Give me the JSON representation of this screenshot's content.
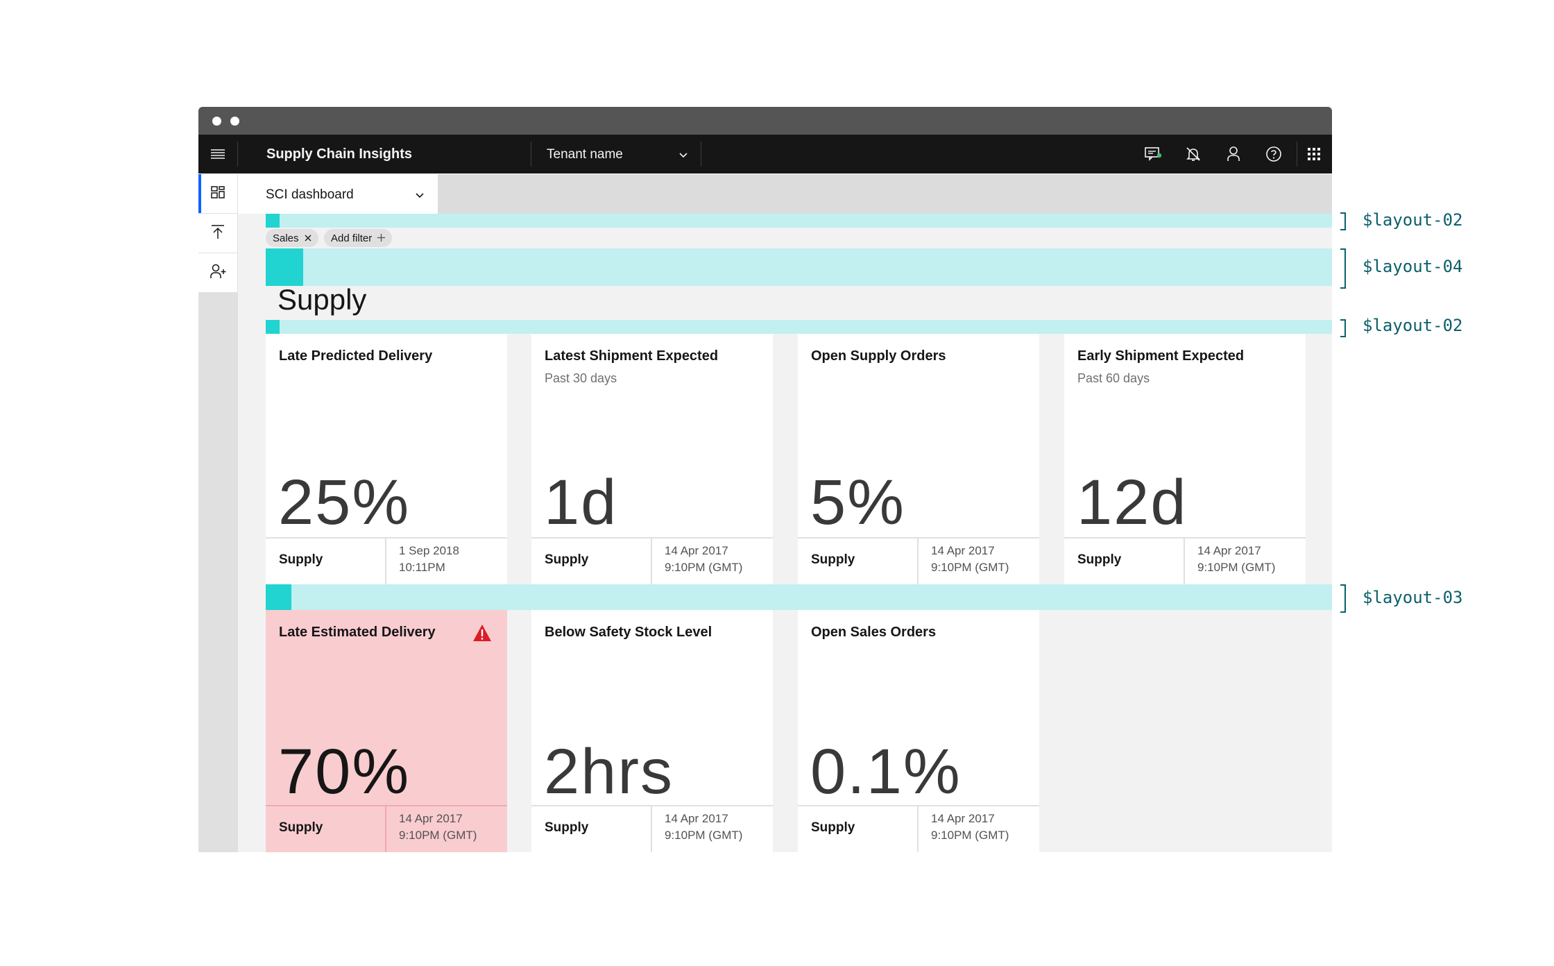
{
  "header": {
    "app_title": "Supply Chain Insights",
    "tenant_label": "Tenant name",
    "icons": [
      "menu-icon",
      "chat-icon",
      "notification-off-icon",
      "user-icon",
      "help-icon",
      "app-switcher-icon"
    ]
  },
  "side_rail": {
    "items": [
      "dashboard-icon",
      "upload-icon",
      "add-user-icon"
    ]
  },
  "dashboard_select": {
    "label": "SCI dashboard"
  },
  "filters": {
    "tags": [
      {
        "label": "Sales"
      }
    ],
    "add_filter_label": "Add filter"
  },
  "section": {
    "title": "Supply"
  },
  "annotations": {
    "layout_02_a": "$layout-02",
    "layout_04": "$layout-04",
    "layout_02_b": "$layout-02",
    "layout_03": "$layout-03"
  },
  "tiles": [
    {
      "title": "Late Predicted Delivery",
      "subtitle": "",
      "value": "25%",
      "footer_label": "Supply",
      "date_line1": "1 Sep 2018",
      "date_line2": "10:11PM",
      "alert": false
    },
    {
      "title": "Latest Shipment Expected",
      "subtitle": "Past 30 days",
      "value": "1d",
      "footer_label": "Supply",
      "date_line1": "14 Apr 2017",
      "date_line2": "9:10PM (GMT)",
      "alert": false
    },
    {
      "title": "Open Supply Orders",
      "subtitle": "",
      "value": "5%",
      "footer_label": "Supply",
      "date_line1": "14 Apr 2017",
      "date_line2": "9:10PM (GMT)",
      "alert": false
    },
    {
      "title": "Early Shipment Expected",
      "subtitle": "Past 60 days",
      "value": "12d",
      "footer_label": "Supply",
      "date_line1": "14 Apr 2017",
      "date_line2": "9:10PM (GMT)",
      "alert": false
    },
    {
      "title": "Late Estimated Delivery",
      "subtitle": "",
      "value": "70%",
      "footer_label": "Supply",
      "date_line1": "14 Apr 2017",
      "date_line2": "9:10PM (GMT)",
      "alert": true
    },
    {
      "title": "Below Safety Stock Level",
      "subtitle": "",
      "value": "2hrs",
      "footer_label": "Supply",
      "date_line1": "14 Apr 2017",
      "date_line2": "9:10PM (GMT)",
      "alert": false
    },
    {
      "title": "Open Sales Orders",
      "subtitle": "",
      "value": "0.1%",
      "footer_label": "Supply",
      "date_line1": "14 Apr 2017",
      "date_line2": "9:10PM (GMT)",
      "alert": false
    }
  ],
  "colors": {
    "header_bg": "#161616",
    "spacer_band": "#c2efef",
    "spacer_swatch": "#21d3d1",
    "alert_tile": "#f9ccd0",
    "warning_icon": "#da1e28",
    "active_rail": "#0f62fe",
    "annotation_text": "#0b5f6a"
  }
}
